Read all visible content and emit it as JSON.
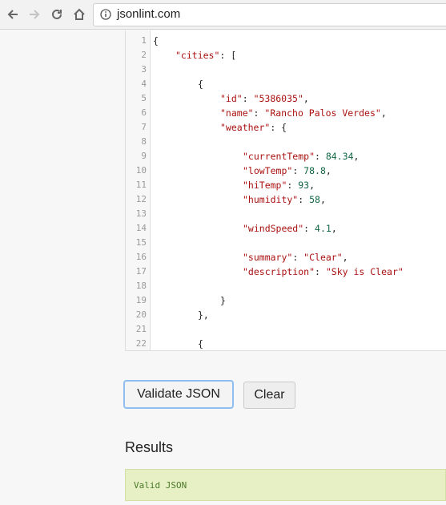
{
  "browser": {
    "url": "jsonlint.com"
  },
  "editor": {
    "lines": [
      {
        "n": "1",
        "tokens": [
          {
            "t": "p",
            "v": "{"
          }
        ],
        "indent": 0
      },
      {
        "n": "2",
        "tokens": [
          {
            "t": "k",
            "v": "\"cities\""
          },
          {
            "t": "p",
            "v": ": ["
          }
        ],
        "indent": 1
      },
      {
        "n": "3",
        "tokens": [],
        "indent": 0
      },
      {
        "n": "4",
        "tokens": [
          {
            "t": "p",
            "v": "{"
          }
        ],
        "indent": 2
      },
      {
        "n": "5",
        "tokens": [
          {
            "t": "k",
            "v": "\"id\""
          },
          {
            "t": "p",
            "v": ": "
          },
          {
            "t": "s",
            "v": "\"5386035\""
          },
          {
            "t": "p",
            "v": ","
          }
        ],
        "indent": 3
      },
      {
        "n": "6",
        "tokens": [
          {
            "t": "k",
            "v": "\"name\""
          },
          {
            "t": "p",
            "v": ": "
          },
          {
            "t": "s",
            "v": "\"Rancho Palos Verdes\""
          },
          {
            "t": "p",
            "v": ","
          }
        ],
        "indent": 3
      },
      {
        "n": "7",
        "tokens": [
          {
            "t": "k",
            "v": "\"weather\""
          },
          {
            "t": "p",
            "v": ": {"
          }
        ],
        "indent": 3
      },
      {
        "n": "8",
        "tokens": [],
        "indent": 0
      },
      {
        "n": "9",
        "tokens": [
          {
            "t": "k",
            "v": "\"currentTemp\""
          },
          {
            "t": "p",
            "v": ": "
          },
          {
            "t": "n",
            "v": "84.34"
          },
          {
            "t": "p",
            "v": ","
          }
        ],
        "indent": 4
      },
      {
        "n": "10",
        "tokens": [
          {
            "t": "k",
            "v": "\"lowTemp\""
          },
          {
            "t": "p",
            "v": ": "
          },
          {
            "t": "n",
            "v": "78.8"
          },
          {
            "t": "p",
            "v": ","
          }
        ],
        "indent": 4
      },
      {
        "n": "11",
        "tokens": [
          {
            "t": "k",
            "v": "\"hiTemp\""
          },
          {
            "t": "p",
            "v": ": "
          },
          {
            "t": "n",
            "v": "93"
          },
          {
            "t": "p",
            "v": ","
          }
        ],
        "indent": 4
      },
      {
        "n": "12",
        "tokens": [
          {
            "t": "k",
            "v": "\"humidity\""
          },
          {
            "t": "p",
            "v": ": "
          },
          {
            "t": "n",
            "v": "58"
          },
          {
            "t": "p",
            "v": ","
          }
        ],
        "indent": 4
      },
      {
        "n": "13",
        "tokens": [],
        "indent": 0
      },
      {
        "n": "14",
        "tokens": [
          {
            "t": "k",
            "v": "\"windSpeed\""
          },
          {
            "t": "p",
            "v": ": "
          },
          {
            "t": "n",
            "v": "4.1"
          },
          {
            "t": "p",
            "v": ","
          }
        ],
        "indent": 4
      },
      {
        "n": "15",
        "tokens": [],
        "indent": 0
      },
      {
        "n": "16",
        "tokens": [
          {
            "t": "k",
            "v": "\"summary\""
          },
          {
            "t": "p",
            "v": ": "
          },
          {
            "t": "s",
            "v": "\"Clear\""
          },
          {
            "t": "p",
            "v": ","
          }
        ],
        "indent": 4
      },
      {
        "n": "17",
        "tokens": [
          {
            "t": "k",
            "v": "\"description\""
          },
          {
            "t": "p",
            "v": ": "
          },
          {
            "t": "s",
            "v": "\"Sky is Clear\""
          }
        ],
        "indent": 4
      },
      {
        "n": "18",
        "tokens": [],
        "indent": 0
      },
      {
        "n": "19",
        "tokens": [
          {
            "t": "p",
            "v": "}"
          }
        ],
        "indent": 3
      },
      {
        "n": "20",
        "tokens": [
          {
            "t": "p",
            "v": "},"
          }
        ],
        "indent": 2
      },
      {
        "n": "21",
        "tokens": [],
        "indent": 0
      },
      {
        "n": "22",
        "tokens": [
          {
            "t": "p",
            "v": "{"
          }
        ],
        "indent": 2
      }
    ]
  },
  "buttons": {
    "validate": "Validate JSON",
    "clear": "Clear"
  },
  "results": {
    "heading": "Results",
    "message": "Valid JSON"
  },
  "icons": {
    "back": "back-arrow-icon",
    "forward": "forward-arrow-icon",
    "reload": "reload-icon",
    "home": "home-icon",
    "info": "info-icon"
  }
}
